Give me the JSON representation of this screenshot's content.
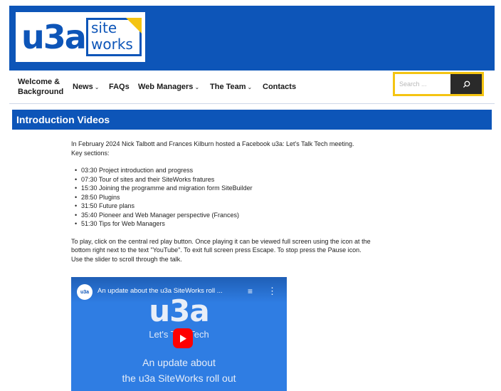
{
  "header": {
    "logo_text": "u3a",
    "logo_site": "site",
    "logo_works": "works"
  },
  "nav": {
    "items": [
      {
        "label": "Welcome & Background"
      },
      {
        "label": "News",
        "caret": "⌄"
      },
      {
        "label": "FAQs"
      },
      {
        "label": "Web Managers",
        "caret": "⌄"
      },
      {
        "label": "The Team",
        "caret": "⌄"
      },
      {
        "label": "Contacts"
      }
    ]
  },
  "search": {
    "placeholder": "Search ...",
    "button_icon": "search-icon"
  },
  "page": {
    "title": "Introduction Videos",
    "intro_1": "In February 2024 Nick Talbott and Frances Kilburn hosted a Facebook u3a: Let's Talk Tech meeting.",
    "intro_2": "Key sections:",
    "sections": [
      "03:30 Project introduction and progress",
      "07:30 Tour of sites and their SiteWorks fratures",
      "15:30 Joining the programme and migration form SiteBuilder",
      "28:50 Plugins",
      "31:50 Future plans",
      "35:40 Pioneer and Web Manager perspective (Frances)",
      "51:30 Tips for Web Managers"
    ],
    "instructions_1": "To play, click on the central red play button. Once playing it can be viewed full screen using the icon at the",
    "instructions_2": "bottom right next to the text \"YouTube\". To exit full screen press Escape. To stop press the Pause icon.",
    "instructions_3": "Use the slider to scroll through the talk."
  },
  "video": {
    "channel_avatar": "u3a",
    "title": "An update about the u3a SiteWorks roll ...",
    "thumb_big": "u3a",
    "thumb_letstalk": "Let's Talk Tech",
    "thumb_sub_1": "An update about",
    "thumb_sub_2": "the u3a SiteWorks roll out",
    "icons": [
      "queue-icon",
      "more-vert-icon",
      "play-icon"
    ]
  },
  "colors": {
    "brand_blue": "#0d55b8",
    "accent_yellow": "#f4c412",
    "play_red": "#ff0000",
    "search_button": "#2a2a2a"
  }
}
